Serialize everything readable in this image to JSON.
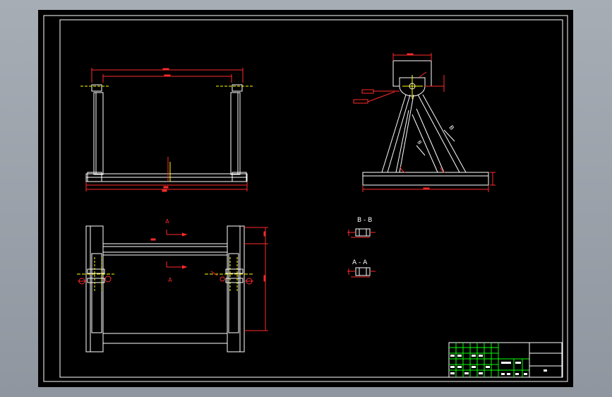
{
  "section_views": {
    "bb_label": "B - B",
    "aa_label": "A - A"
  },
  "plan_view": {
    "cut_label_top": "A",
    "cut_label_bottom": "A"
  },
  "side_view": {
    "view_arrow_label": "B"
  },
  "colors": {
    "background": "#000000",
    "outline": "#ffffff",
    "dimension": "#ff2a2a",
    "centerline": "#ffff00",
    "title_block": "#00ff00"
  }
}
